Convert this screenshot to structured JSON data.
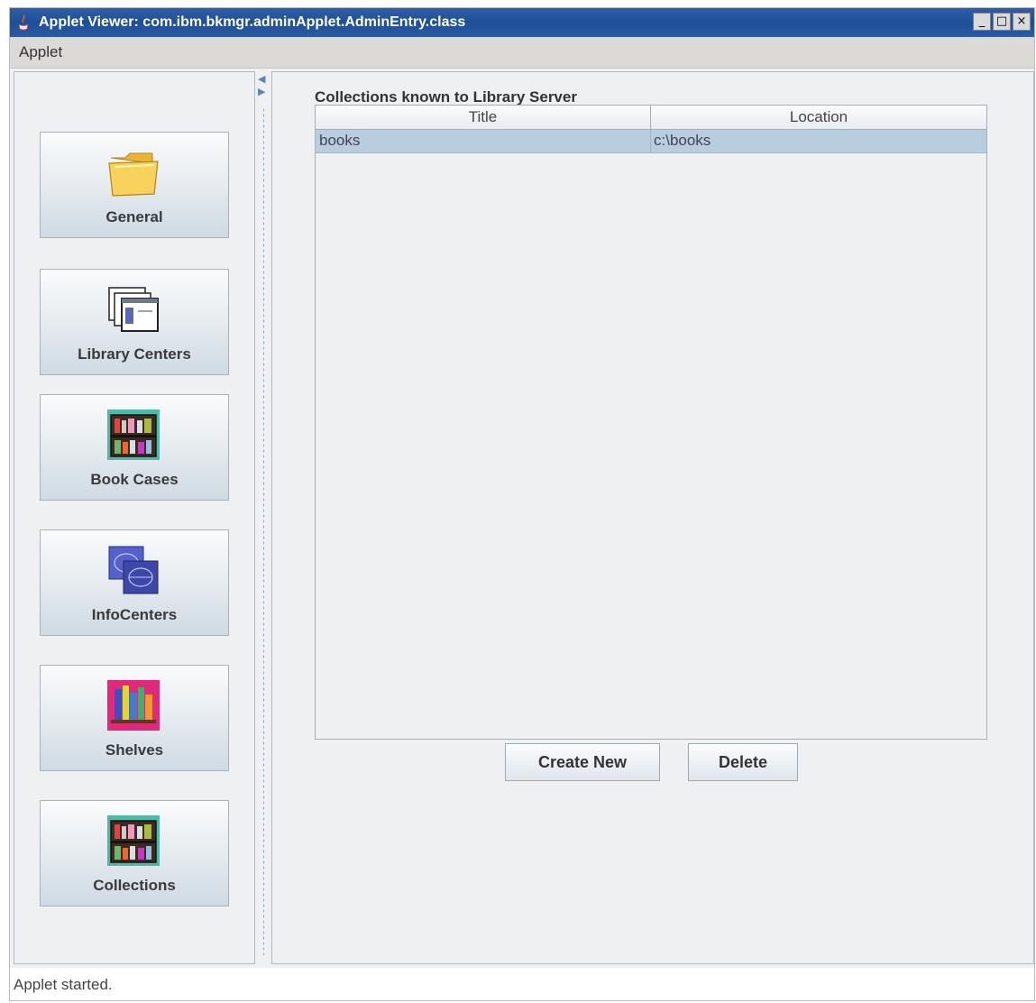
{
  "window": {
    "title": "Applet Viewer: com.ibm.bkmgr.adminApplet.AdminEntry.class",
    "minimize": "_",
    "maximize": "□",
    "close": "×"
  },
  "menubar": {
    "items": [
      "Applet"
    ]
  },
  "sidebar": {
    "items": [
      {
        "label": "General",
        "icon": "folder-icon"
      },
      {
        "label": "Library Centers",
        "icon": "library-centers-icon"
      },
      {
        "label": "Book Cases",
        "icon": "bookcase-icon"
      },
      {
        "label": "InfoCenters",
        "icon": "infocenters-icon"
      },
      {
        "label": "Shelves",
        "icon": "shelves-icon"
      },
      {
        "label": "Collections",
        "icon": "collections-icon"
      }
    ]
  },
  "main": {
    "section_label": "Collections known to Library Server",
    "table": {
      "columns": [
        "Title",
        "Location"
      ],
      "rows": [
        [
          "books",
          "c:\\books"
        ]
      ]
    },
    "buttons": {
      "create": "Create New",
      "delete": "Delete"
    }
  },
  "status": {
    "text": "Applet started."
  },
  "colors": {
    "titlebar": "#1d4f98",
    "selection": "#b8cde0",
    "panel": "#eef0f2"
  }
}
